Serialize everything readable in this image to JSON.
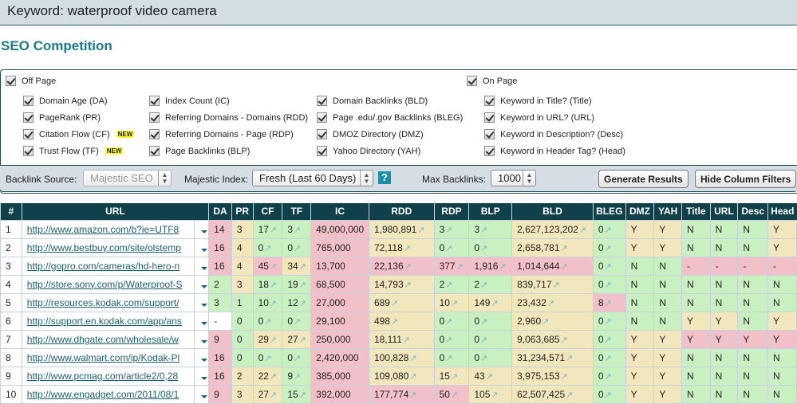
{
  "keyword_bar": {
    "label": "Keyword:",
    "value": "waterproof video camera"
  },
  "page_title": "SEO Competition",
  "filters": {
    "off_page": {
      "label": "Off Page",
      "checked": true
    },
    "on_page": {
      "label": "On Page",
      "checked": true
    },
    "col1": [
      {
        "label": "Domain Age (DA)",
        "checked": true
      },
      {
        "label": "PageRank (PR)",
        "checked": true
      },
      {
        "label": "Citation Flow (CF)",
        "checked": true,
        "badge": "NEW"
      },
      {
        "label": "Trust Flow (TF)",
        "checked": true,
        "badge": "NEW"
      }
    ],
    "col2": [
      {
        "label": "Index Count (IC)",
        "checked": true
      },
      {
        "label": "Referring Domains - Domains (RDD)",
        "checked": true
      },
      {
        "label": "Referring Domains - Page (RDP)",
        "checked": true
      },
      {
        "label": "Page Backlinks (BLP)",
        "checked": true
      }
    ],
    "col3": [
      {
        "label": "Domain Backlinks (BLD)",
        "checked": true
      },
      {
        "label": "Page .edu/.gov Backlinks (BLEG)",
        "checked": true
      },
      {
        "label": "DMOZ Directory (DMZ)",
        "checked": true
      },
      {
        "label": "Yahoo Directory (YAH)",
        "checked": true
      }
    ],
    "col4": [
      {
        "label": "Keyword in Title? (Title)",
        "checked": true
      },
      {
        "label": "Keyword in URL? (URL)",
        "checked": true
      },
      {
        "label": "Keyword in Description? (Desc)",
        "checked": true
      },
      {
        "label": "Keyword in Header Tag? (Head)",
        "checked": true
      }
    ]
  },
  "toolbar": {
    "backlink_source_label": "Backlink Source:",
    "backlink_source_value": "Majestic SEO",
    "majestic_index_label": "Majestic Index:",
    "majestic_index_value": "Fresh (Last 60 Days)",
    "help_label": "?",
    "max_backlinks_label": "Max Backlinks:",
    "max_backlinks_value": "1000",
    "generate_label": "Generate Results",
    "hide_filters_label": "Hide Column Filters"
  },
  "table": {
    "headers": [
      "#",
      "URL",
      "DA",
      "PR",
      "CF",
      "TF",
      "IC",
      "RDD",
      "RDP",
      "BLP",
      "BLD",
      "BLEG",
      "DMZ",
      "YAH",
      "Title",
      "URL",
      "Desc",
      "Head"
    ],
    "rows": [
      {
        "n": "1",
        "url": "http://www.amazon.com/b?ie=UTF8",
        "da": "14",
        "pr": "3",
        "cf": "17",
        "tf": "3",
        "ic": "49,000,000",
        "rdd": "1,980,891",
        "rdp": "3",
        "blp": "3",
        "bld": "2,627,123,202",
        "bleg": "0",
        "dmz": "Y",
        "yah": "Y",
        "title": "N",
        "urlk": "N",
        "desc": "N",
        "head": "Y",
        "c": [
          "r",
          "y",
          "g",
          "g",
          "r",
          "y",
          "g",
          "g",
          "y",
          "g",
          "y",
          "y",
          "g",
          "g",
          "g",
          "y"
        ]
      },
      {
        "n": "2",
        "url": "http://www.bestbuy.com/site/olstemp",
        "da": "16",
        "pr": "4",
        "cf": "0",
        "tf": "0",
        "ic": "765,000",
        "rdd": "72,118",
        "rdp": "0",
        "blp": "0",
        "bld": "2,658,781",
        "bleg": "0",
        "dmz": "Y",
        "yah": "Y",
        "title": "N",
        "urlk": "N",
        "desc": "N",
        "head": "Y",
        "c": [
          "r",
          "y",
          "g",
          "g",
          "r",
          "y",
          "g",
          "g",
          "y",
          "g",
          "y",
          "y",
          "g",
          "g",
          "g",
          "y"
        ]
      },
      {
        "n": "3",
        "url": "http://gopro.com/cameras/hd-hero-n",
        "da": "16",
        "pr": "4",
        "cf": "45",
        "tf": "34",
        "ic": "13,700",
        "rdd": "22,136",
        "rdp": "377",
        "blp": "1,916",
        "bld": "1,014,644",
        "bleg": "0",
        "dmz": "N",
        "yah": "N",
        "title": "-",
        "urlk": "-",
        "desc": "-",
        "head": "-",
        "c": [
          "r",
          "y",
          "r",
          "y",
          "r",
          "r",
          "r",
          "r",
          "r",
          "g",
          "g",
          "g",
          "r",
          "r",
          "r",
          "r"
        ]
      },
      {
        "n": "4",
        "url": "http://store.sony.com/p/Waterproof-S",
        "da": "2",
        "pr": "3",
        "cf": "18",
        "tf": "19",
        "ic": "68,500",
        "rdd": "14,793",
        "rdp": "2",
        "blp": "2",
        "bld": "839,717",
        "bleg": "0",
        "dmz": "N",
        "yah": "N",
        "title": "N",
        "urlk": "N",
        "desc": "N",
        "head": "N",
        "c": [
          "g",
          "y",
          "g",
          "g",
          "r",
          "y",
          "g",
          "g",
          "y",
          "g",
          "g",
          "g",
          "g",
          "g",
          "g",
          "g"
        ]
      },
      {
        "n": "5",
        "url": "http://resources.kodak.com/support/",
        "da": "3",
        "pr": "1",
        "cf": "10",
        "tf": "12",
        "ic": "27,000",
        "rdd": "689",
        "rdp": "10",
        "blp": "149",
        "bld": "23,432",
        "bleg": "8",
        "dmz": "N",
        "yah": "N",
        "title": "N",
        "urlk": "N",
        "desc": "N",
        "head": "N",
        "c": [
          "g",
          "g",
          "g",
          "g",
          "r",
          "y",
          "y",
          "y",
          "y",
          "r",
          "g",
          "g",
          "g",
          "g",
          "g",
          "g"
        ]
      },
      {
        "n": "6",
        "url": "http://support.en.kodak.com/app/ans",
        "da": "-",
        "pr": "0",
        "cf": "0",
        "tf": "0",
        "ic": "29,100",
        "rdd": "498",
        "rdp": "0",
        "blp": "0",
        "bld": "2,960",
        "bleg": "0",
        "dmz": "N",
        "yah": "N",
        "title": "Y",
        "urlk": "Y",
        "desc": "N",
        "head": "Y",
        "c": [
          "w",
          "g",
          "g",
          "g",
          "r",
          "y",
          "g",
          "g",
          "y",
          "g",
          "g",
          "g",
          "y",
          "y",
          "g",
          "y"
        ]
      },
      {
        "n": "7",
        "url": "http://www.dhgate.com/wholesale/w",
        "da": "9",
        "pr": "0",
        "cf": "29",
        "tf": "27",
        "ic": "250,000",
        "rdd": "18,111",
        "rdp": "0",
        "blp": "0",
        "bld": "9,063,685",
        "bleg": "0",
        "dmz": "Y",
        "yah": "Y",
        "title": "Y",
        "urlk": "Y",
        "desc": "Y",
        "head": "Y",
        "c": [
          "r",
          "g",
          "y",
          "y",
          "r",
          "y",
          "g",
          "g",
          "y",
          "g",
          "y",
          "y",
          "r",
          "r",
          "r",
          "r"
        ]
      },
      {
        "n": "8",
        "url": "http://www.walmart.com/ip/Kodak-Pl",
        "da": "16",
        "pr": "0",
        "cf": "0",
        "tf": "0",
        "ic": "2,420,000",
        "rdd": "100,828",
        "rdp": "0",
        "blp": "0",
        "bld": "31,234,571",
        "bleg": "0",
        "dmz": "Y",
        "yah": "Y",
        "title": "N",
        "urlk": "N",
        "desc": "N",
        "head": "N",
        "c": [
          "r",
          "g",
          "g",
          "g",
          "r",
          "y",
          "g",
          "g",
          "y",
          "g",
          "y",
          "y",
          "g",
          "g",
          "g",
          "g"
        ]
      },
      {
        "n": "9",
        "url": "http://www.pcmag.com/article2/0,28",
        "da": "16",
        "pr": "2",
        "cf": "22",
        "tf": "9",
        "ic": "385,000",
        "rdd": "109,080",
        "rdp": "15",
        "blp": "43",
        "bld": "3,975,153",
        "bleg": "0",
        "dmz": "Y",
        "yah": "Y",
        "title": "N",
        "urlk": "N",
        "desc": "N",
        "head": "N",
        "c": [
          "r",
          "y",
          "y",
          "g",
          "r",
          "y",
          "y",
          "y",
          "y",
          "g",
          "y",
          "y",
          "g",
          "g",
          "g",
          "g"
        ]
      },
      {
        "n": "10",
        "url": "http://www.engadget.com/2011/08/1",
        "da": "9",
        "pr": "3",
        "cf": "27",
        "tf": "15",
        "ic": "392,000",
        "rdd": "177,774",
        "rdp": "50",
        "blp": "105",
        "bld": "62,507,425",
        "bleg": "0",
        "dmz": "Y",
        "yah": "Y",
        "title": "N",
        "urlk": "N",
        "desc": "N",
        "head": "N",
        "c": [
          "r",
          "y",
          "y",
          "g",
          "r",
          "r",
          "r",
          "y",
          "y",
          "g",
          "y",
          "y",
          "g",
          "g",
          "g",
          "g"
        ]
      }
    ]
  },
  "icons": {
    "trend": "trend-arrow-icon",
    "dropdown": "dropdown-arrow-icon",
    "checkbox": "checkbox-checked-icon"
  }
}
